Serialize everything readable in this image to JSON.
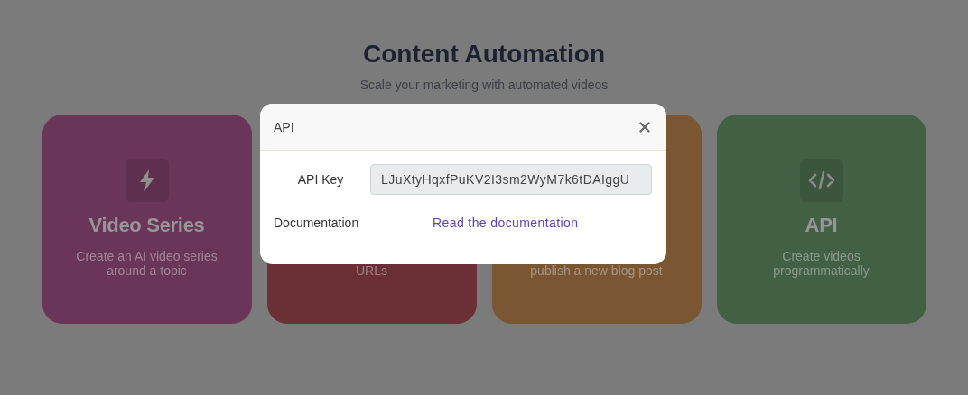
{
  "header": {
    "title": "Content Automation",
    "subtitle": "Scale your marketing with automated videos"
  },
  "cards": [
    {
      "kind": "lightning",
      "title": "Video Series",
      "description_lines": [
        "Create an AI video series",
        "around a topic"
      ],
      "color": "#6a3559"
    },
    {
      "kind": "covered",
      "description_lines": [
        "URLs"
      ],
      "color": "#6a3035"
    },
    {
      "kind": "covered",
      "description_lines": [
        "publish a new blog post"
      ],
      "color": "#7a5632"
    },
    {
      "kind": "code",
      "title": "API",
      "description_lines": [
        "Create videos",
        "programmatically"
      ],
      "color": "#426044"
    }
  ],
  "modal": {
    "title": "API",
    "fields": [
      {
        "kind": "input",
        "label": "API Key",
        "value": "LJuXtyHqxfPuKV2I3sm2WyM7k6tDAIggU"
      },
      {
        "kind": "link",
        "label": "Documentation",
        "value": "Read the documentation"
      }
    ]
  }
}
